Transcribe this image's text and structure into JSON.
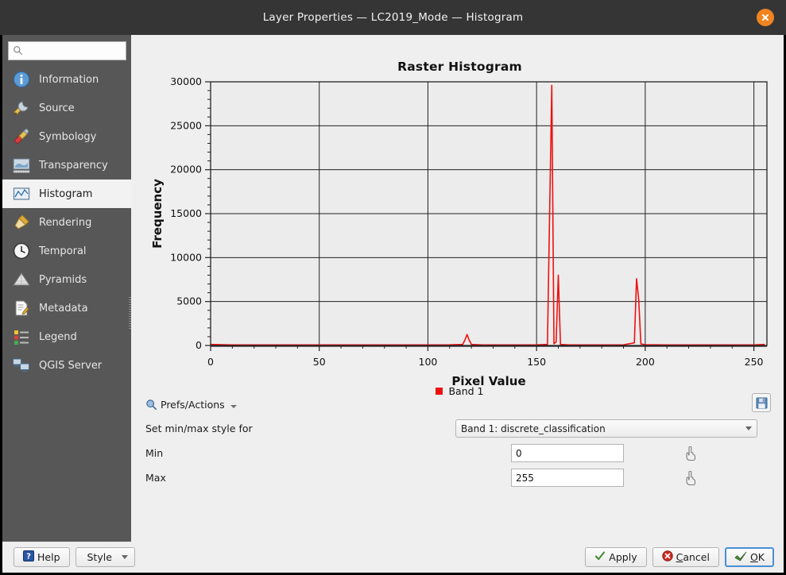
{
  "window": {
    "title": "Layer Properties — LC2019_Mode — Histogram",
    "close_icon": "close-icon"
  },
  "sidebar": {
    "search": {
      "value": "",
      "placeholder": "",
      "icon": "search-icon"
    },
    "items": [
      {
        "label": "Information",
        "icon": "information-icon",
        "selected": false
      },
      {
        "label": "Source",
        "icon": "source-icon",
        "selected": false
      },
      {
        "label": "Symbology",
        "icon": "symbology-icon",
        "selected": false
      },
      {
        "label": "Transparency",
        "icon": "transparency-icon",
        "selected": false
      },
      {
        "label": "Histogram",
        "icon": "histogram-icon",
        "selected": true
      },
      {
        "label": "Rendering",
        "icon": "rendering-icon",
        "selected": false
      },
      {
        "label": "Temporal",
        "icon": "temporal-icon",
        "selected": false
      },
      {
        "label": "Pyramids",
        "icon": "pyramids-icon",
        "selected": false
      },
      {
        "label": "Metadata",
        "icon": "metadata-icon",
        "selected": false
      },
      {
        "label": "Legend",
        "icon": "legend-icon",
        "selected": false
      },
      {
        "label": "QGIS Server",
        "icon": "qgis-server-icon",
        "selected": false
      }
    ]
  },
  "chart_data": {
    "type": "line",
    "title": "Raster Histogram",
    "xlabel": "Pixel Value",
    "ylabel": "Frequency",
    "xlim": [
      0,
      256
    ],
    "ylim": [
      0,
      30000
    ],
    "xticks": [
      0,
      50,
      100,
      150,
      200,
      250
    ],
    "yticks": [
      0,
      5000,
      10000,
      15000,
      20000,
      25000,
      30000
    ],
    "grid": true,
    "legend_position": "bottom",
    "series": [
      {
        "name": "Band 1",
        "color": "#ee1111",
        "points": [
          [
            0,
            120
          ],
          [
            10,
            60
          ],
          [
            20,
            60
          ],
          [
            30,
            60
          ],
          [
            40,
            60
          ],
          [
            50,
            60
          ],
          [
            60,
            60
          ],
          [
            70,
            60
          ],
          [
            80,
            60
          ],
          [
            90,
            60
          ],
          [
            100,
            60
          ],
          [
            110,
            70
          ],
          [
            116,
            120
          ],
          [
            117,
            600
          ],
          [
            118,
            1250
          ],
          [
            119,
            600
          ],
          [
            120,
            120
          ],
          [
            125,
            60
          ],
          [
            130,
            60
          ],
          [
            140,
            60
          ],
          [
            150,
            70
          ],
          [
            155,
            120
          ],
          [
            156,
            15000
          ],
          [
            157,
            29600
          ],
          [
            158,
            200
          ],
          [
            159,
            400
          ],
          [
            160,
            8000
          ],
          [
            161,
            120
          ],
          [
            165,
            60
          ],
          [
            170,
            60
          ],
          [
            180,
            60
          ],
          [
            190,
            80
          ],
          [
            195,
            300
          ],
          [
            196,
            7600
          ],
          [
            197,
            5200
          ],
          [
            198,
            180
          ],
          [
            200,
            90
          ],
          [
            210,
            60
          ],
          [
            220,
            60
          ],
          [
            230,
            60
          ],
          [
            240,
            60
          ],
          [
            250,
            60
          ],
          [
            255,
            120
          ]
        ]
      }
    ],
    "peaks": [
      {
        "x": 157,
        "y": 29600,
        "label": ""
      },
      {
        "x": 160,
        "y": 8000,
        "label": ""
      },
      {
        "x": 196,
        "y": 7600,
        "label": ""
      },
      {
        "x": 197,
        "y": 5200,
        "label": ""
      },
      {
        "x": 118,
        "y": 1250,
        "label": ""
      }
    ]
  },
  "legend": {
    "label": "Band 1",
    "color": "#ee1111"
  },
  "controls": {
    "prefs_actions": {
      "label": "Prefs/Actions",
      "icon": "magnifier-prefs-icon"
    },
    "save_icon": "save-floppy-icon",
    "minmax_style_label": "Set min/max style for",
    "band_select": {
      "value": "Band 1: discrete_classification"
    },
    "min_label": "Min",
    "min_value": "0",
    "max_label": "Max",
    "max_value": "255",
    "pick_icon": "pointer-pick-icon"
  },
  "buttons": {
    "help": {
      "label": "Help",
      "icon": "help-question-icon"
    },
    "style": {
      "label": "Style",
      "icon": "chevron-down-icon"
    },
    "apply": {
      "label": "Apply",
      "icon": "check-icon"
    },
    "cancel": {
      "label": "Cancel",
      "icon": "cancel-x-icon"
    },
    "ok": {
      "label": "OK",
      "icon": "ok-arrow-icon"
    }
  }
}
